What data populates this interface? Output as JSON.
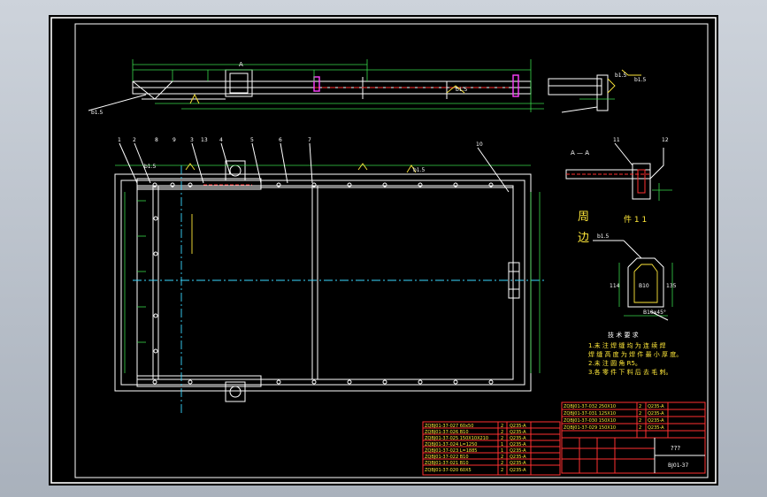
{
  "drawing": {
    "detail_a_label": "A",
    "section_a_label": "A — A",
    "callout_numbers": [
      "1",
      "2",
      "3",
      "4",
      "5",
      "6",
      "7",
      "8",
      "9",
      "10",
      "11",
      "12",
      "13"
    ],
    "weld_symbols": [
      "b1.5",
      "b1.5",
      "b1.5",
      "b1.5",
      "b1.5"
    ],
    "edge_note": {
      "char1": "周",
      "char2": "边",
      "part_label": "件 1 1",
      "weld": "b1.5",
      "dim_h": "114",
      "dim_w": "B10",
      "dim_side": "135",
      "chamfer": "B10x45°"
    },
    "tech_req": {
      "title": "技 术 要 求",
      "lines": [
        "1.未 注 焊 缝 均 为 连 续 焊",
        "   焊 缝 高 度 为 焊 件 最 小 厚 度。",
        "2.未 注 圆 角 R5。",
        "3.各 零 件 下 料 后 去 毛 刺。"
      ]
    }
  },
  "parts_list_left": [
    {
      "code": "ZQBJ01-37-027  60x50",
      "qty": "2",
      "material": "Q235-A"
    },
    {
      "code": "ZQBJ01-37-026  B10",
      "qty": "2",
      "material": "Q235-A"
    },
    {
      "code": "ZQBJ01-37-025  150X10X210",
      "qty": "2",
      "material": "Q235-A"
    },
    {
      "code": "ZQBJ01-37-024  L=1250",
      "qty": "1",
      "material": "Q235-A"
    },
    {
      "code": "ZQBJ01-37-023  L=1885",
      "qty": "1",
      "material": "Q235-A"
    },
    {
      "code": "ZQBJ01-37-022  B10",
      "qty": "2",
      "material": "Q235-A"
    },
    {
      "code": "ZQBJ01-37-021  B10",
      "qty": "2",
      "material": "Q235-A"
    },
    {
      "code": "ZQBJ01-37-020  60X5",
      "qty": "2",
      "material": "Q235-A"
    }
  ],
  "parts_list_right": [
    {
      "code": "ZQBJ01-37-032  250X10",
      "qty": "2",
      "material": "Q235-A"
    },
    {
      "code": "ZQBJ01-37-031  125X10",
      "qty": "2",
      "material": "Q235-A"
    },
    {
      "code": "ZQBJ01-37-030  150X10",
      "qty": "2",
      "material": "Q235-A"
    },
    {
      "code": "ZQBJ01-37-029  150X10",
      "qty": "2",
      "material": "Q235-A"
    }
  ],
  "title_block": {
    "drawing_name": "???",
    "drawing_no": "BJ01-37"
  }
}
